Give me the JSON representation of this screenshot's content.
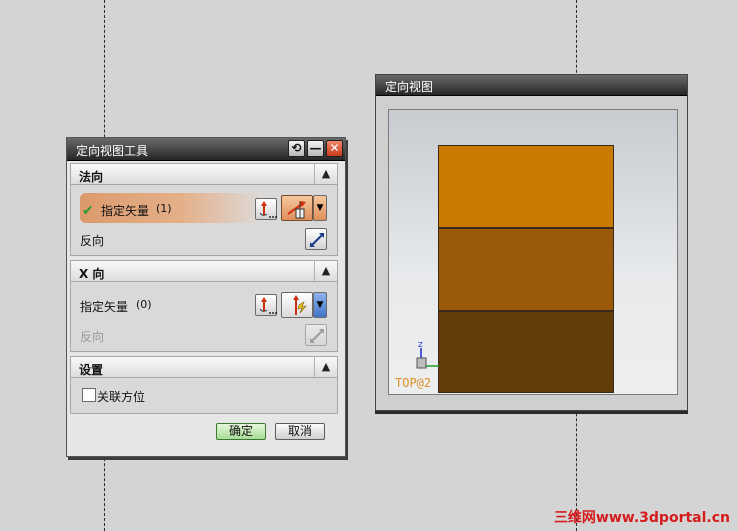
{
  "dialog": {
    "title": "定向视图工具",
    "title_buttons": {
      "reset": "⟲",
      "minimize": "—",
      "close": "✕"
    },
    "section_normal": {
      "header": "法向",
      "specify_vector_label": "指定矢量",
      "specify_vector_count": "(1)",
      "reverse_label": "反向",
      "icons": [
        "vector-dialog-icon",
        "vector-type-icon",
        "dropdown-arrow-icon",
        "reverse-direction-icon"
      ]
    },
    "section_x": {
      "header": "X 向",
      "specify_vector_label": "指定矢量",
      "specify_vector_count": "(0)",
      "reverse_label": "反向",
      "reverse_disabled": true
    },
    "section_settings": {
      "header": "设置",
      "associative_label": "关联方位",
      "associative_checked": false
    },
    "ok_label": "确定",
    "cancel_label": "取消"
  },
  "view_window": {
    "title": "定向视图",
    "view_name": "TOP@2",
    "axis_label": "Z",
    "block_colors": [
      "#c97a00",
      "#9a5a0a",
      "#643c0a"
    ]
  },
  "watermark": "三维网www.3dportal.cn",
  "colors": {
    "selected_row": "#dc9a6c",
    "check": "#2e9a2e",
    "ok_button": "#a8dc98",
    "view_label": "#e0902a",
    "watermark": "#d41c1c"
  }
}
